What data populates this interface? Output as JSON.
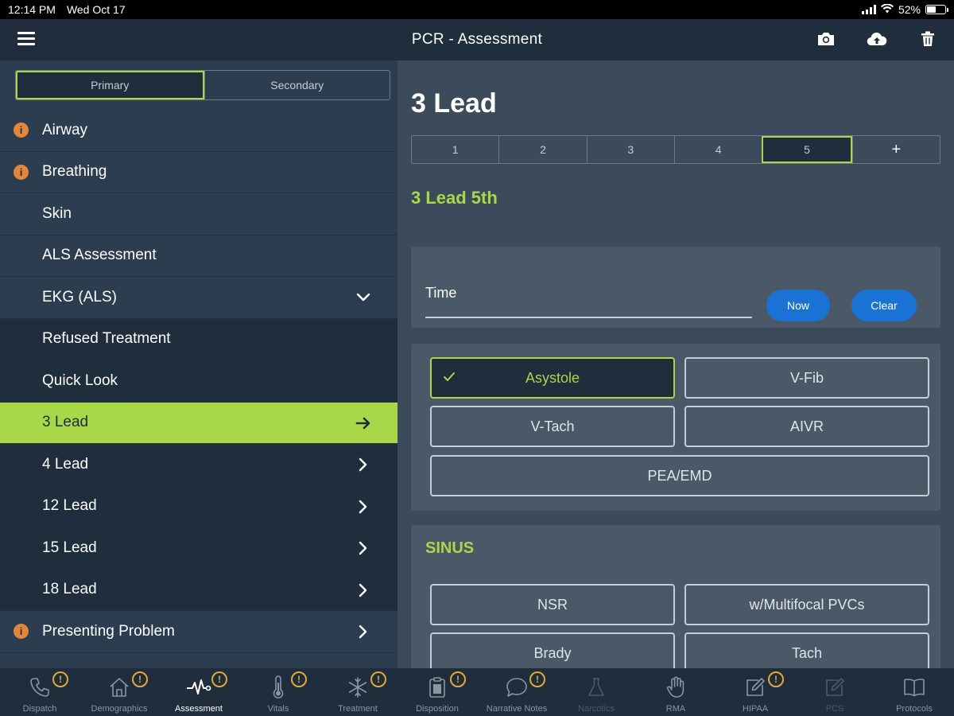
{
  "status_bar": {
    "time": "12:14 PM",
    "date": "Wed Oct 17",
    "battery": "52%",
    "battery_level": 0.52
  },
  "header": {
    "title": "PCR - Assessment",
    "menu_icon": "hamburger-menu-icon",
    "actions": [
      "camera-icon",
      "cloud-upload-icon",
      "trash-icon"
    ]
  },
  "sidebar": {
    "segments": {
      "primary": "Primary",
      "secondary": "Secondary",
      "selected": "Primary"
    },
    "items": [
      {
        "label": "Airway",
        "alert": true
      },
      {
        "label": "Breathing",
        "alert": true
      },
      {
        "label": "Skin"
      },
      {
        "label": "ALS Assessment"
      },
      {
        "label": "EKG (ALS)",
        "expanded": true
      },
      {
        "label": "Refused Treatment"
      },
      {
        "label": "Quick Look"
      },
      {
        "label": "3 Lead",
        "active": true
      },
      {
        "label": "4 Lead"
      },
      {
        "label": "12 Lead"
      },
      {
        "label": "15 Lead"
      },
      {
        "label": "18 Lead"
      },
      {
        "label": "Presenting Problem",
        "alert": true
      }
    ]
  },
  "main": {
    "title": "3 Lead",
    "tabs": [
      "1",
      "2",
      "3",
      "4",
      "5",
      "+"
    ],
    "selected_tab": "5",
    "subtitle": "3 Lead 5th",
    "time_label": "Time",
    "now_button": "Now",
    "clear_button": "Clear",
    "rhythms": {
      "asystole": "Asystole",
      "vfib": "V-Fib",
      "vtach": "V-Tach",
      "aivr": "AIVR",
      "pea": "PEA/EMD",
      "selected": "Asystole"
    },
    "sinus": {
      "heading": "SINUS",
      "nsr": "NSR",
      "pvcs": "w/Multifocal PVCs",
      "brady": "Brady",
      "tach": "Tach"
    }
  },
  "tabbar": [
    {
      "label": "Dispatch",
      "icon": "phone-icon",
      "badge": "!"
    },
    {
      "label": "Demographics",
      "icon": "house-icon",
      "badge": "!"
    },
    {
      "label": "Assessment",
      "icon": "heartbeat-icon",
      "badge": "!",
      "active": true
    },
    {
      "label": "Vitals",
      "icon": "thermometer-icon",
      "badge": "!"
    },
    {
      "label": "Treatment",
      "icon": "snowflake-icon",
      "badge": "!"
    },
    {
      "label": "Disposition",
      "icon": "clipboard-icon",
      "badge": "!"
    },
    {
      "label": "Narrative Notes",
      "icon": "speech-bubble-icon",
      "badge": "!"
    },
    {
      "label": "Narcotics",
      "icon": "flask-icon",
      "disabled": true
    },
    {
      "label": "RMA",
      "icon": "hand-icon"
    },
    {
      "label": "HIPAA",
      "icon": "edit-icon",
      "badge": "!"
    },
    {
      "label": "PCS",
      "icon": "edit-icon",
      "disabled": true
    },
    {
      "label": "Protocols",
      "icon": "book-icon"
    }
  ],
  "colors": {
    "accent": "#a8d84a",
    "panel": "#3b4b5c",
    "sidebar": "#2c3d50",
    "navbar": "#1f2d3d",
    "button_blue": "#1a73d4",
    "alert": "#e3853a"
  }
}
